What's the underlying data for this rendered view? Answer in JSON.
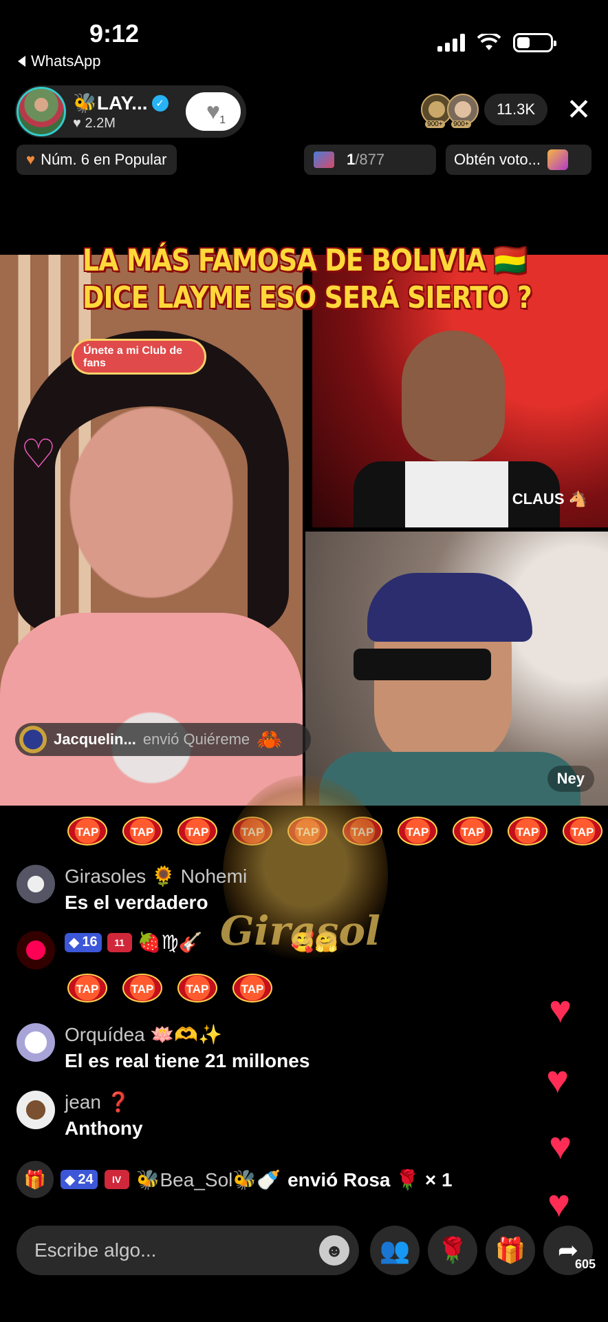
{
  "status_bar": {
    "time": "9:12",
    "back_app": "WhatsApp"
  },
  "host": {
    "name": "🐝LAY...",
    "likes": "2.2M",
    "follow_count": "1"
  },
  "viewers": {
    "count": "11.3K",
    "avatar_tags": [
      "900+",
      "900+"
    ]
  },
  "ranking": {
    "label": "Núm. 6 en Popular"
  },
  "quest": {
    "current": "1",
    "total": "/877"
  },
  "vote": {
    "label": "Obtén voto..."
  },
  "headline": {
    "line1": "LA MÁS FAMOSA DE BOLIVIA 🇧🇴",
    "line2": "DICE LAYME ESO SERÁ SIERTO ?"
  },
  "fan_club": {
    "label": "Únete a mi Club de fans"
  },
  "guests": {
    "claus": "CLAUS 🐴",
    "ney": "Ney"
  },
  "gift_toast": {
    "user": "Jacquelin...",
    "action": "envió Quiéreme"
  },
  "tap_label": "TAP",
  "chat": [
    {
      "user": "Girasoles 🌻 Nohemi",
      "text": "Es el verdadero"
    },
    {
      "level": "16",
      "fan": "11",
      "emojis": "🍓♍🎸",
      "extra": "🥰🤗"
    },
    {
      "user": "Orquídea 🪷🫶✨",
      "text": "El es real tiene 21 millones"
    },
    {
      "user": "jean ❓",
      "text": "Anthony"
    }
  ],
  "gift_event": {
    "level": "24",
    "fan": "IV",
    "name": "🐝Bea_Sol🐝🍼",
    "action": "envió Rosa 🌹 × 1"
  },
  "watermark": {
    "text": "Girasol"
  },
  "input": {
    "placeholder": "Escribe algo..."
  },
  "share": {
    "count": "605"
  },
  "colors": {
    "accent_red": "#ff2d55",
    "headline_yellow": "#ffd83a",
    "level_blue": "#3c57d8"
  }
}
